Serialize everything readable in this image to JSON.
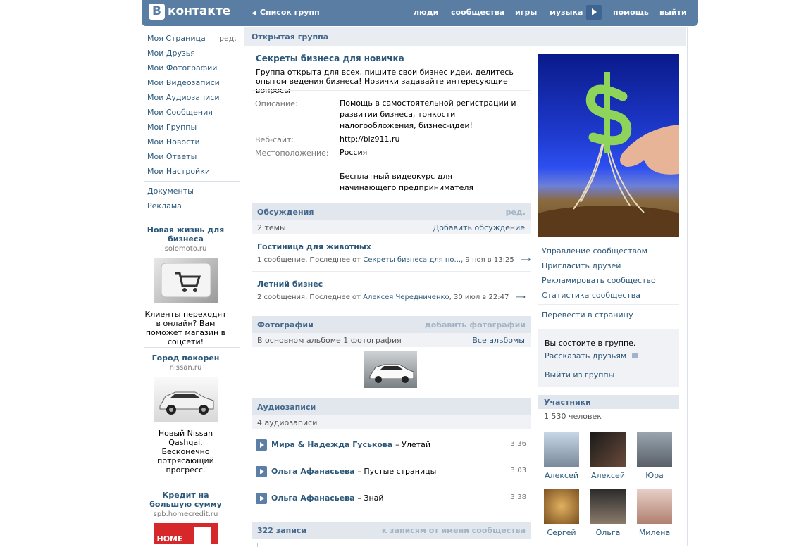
{
  "header": {
    "logo_letter": "В",
    "logo_text": "контакте",
    "back_label": "Список групп",
    "nav": [
      "люди",
      "сообщества",
      "игры",
      "музыка",
      "помощь",
      "выйти"
    ]
  },
  "sidebar": {
    "items": [
      "Моя Страница",
      "Мои Друзья",
      "Мои Фотографии",
      "Мои Видеозаписи",
      "Мои Аудиозаписи",
      "Мои Сообщения",
      "Мои Группы",
      "Мои Новости",
      "Мои Ответы",
      "Мои Настройки"
    ],
    "edit_label": "ред.",
    "extra": [
      "Документы",
      "Реклама"
    ],
    "ads": [
      {
        "title": "Новая жизнь для бизнеса",
        "domain": "solomoto.ru",
        "text": "Клиенты переходят в онлайн? Вам поможет магазин в соцсети!"
      },
      {
        "title": "Город покорен",
        "domain": "nissan.ru",
        "text": "Новый Nissan Qashqai. Бесконечно потрясающий прогресс."
      },
      {
        "title": "Кредит на большую сумму",
        "domain": "spb.homecredit.ru",
        "image_text": "HOME"
      }
    ]
  },
  "group": {
    "type_label": "Открытая группа",
    "name": "Секреты бизнеса для новичка",
    "status": "Группа открыта для всех, пишите свои бизнес идеи, делитесь опытом ведения бизнеса! Новички задавайте интересующие вопросы",
    "info": [
      {
        "label": "Описание:",
        "value": "Помощь в самостоятельной регистрации и развитии бизнеса, тонкости налогообложения, бизнес-идеи!"
      },
      {
        "label": "Веб-сайт:",
        "value": "http://biz911.ru"
      },
      {
        "label": "Местоположение:",
        "value": "Россия"
      }
    ],
    "promo": "Бесплатный видеокурс для начинающего предпринимателя"
  },
  "discussions": {
    "title": "Обсуждения",
    "edit": "ред.",
    "count": "2 темы",
    "add": "Добавить обсуждение",
    "topics": [
      {
        "title": "Гостиница для животных",
        "meta_prefix": "1 сообщение. Последнее от",
        "author": "Секреты бизнеса для но...",
        "date": ", 9 ноя в 13:25"
      },
      {
        "title": "Летний бизнес",
        "meta_prefix": "2 сообщения. Последнее от",
        "author": "Алексея Чередниченко",
        "date": ", 30 июл в 22:47"
      }
    ],
    "arrow": "⟶"
  },
  "photos": {
    "title": "Фотографии",
    "add": "добавить фотографии",
    "count": "В основном альбоме 1 фотография",
    "all": "Все альбомы"
  },
  "audio": {
    "title": "Аудиозаписи",
    "count": "4 аудиозаписи",
    "tracks": [
      {
        "artist": "Мира & Надежда Гуськова",
        "title": "– Улетай",
        "duration": "3:36"
      },
      {
        "artist": "Ольга Афанасьева",
        "title": "– Пустые страницы",
        "duration": "3:03"
      },
      {
        "artist": "Ольга Афанасьева",
        "title": "– Знай",
        "duration": "3:38"
      }
    ]
  },
  "wall": {
    "count": "322 записи",
    "link": "к записям от имени сообщества"
  },
  "actions": {
    "links": [
      "Управление сообществом",
      "Пригласить друзей",
      "Рекламировать сообщество",
      "Статистика сообщества"
    ],
    "convert": "Перевести в страницу",
    "member_status": "Вы состоите в группе.",
    "tell": "Рассказать друзьям",
    "leave": "Выйти из группы"
  },
  "members": {
    "title": "Участники",
    "count": "1 530 человек",
    "list": [
      "Алексей",
      "Алексей",
      "Юра",
      "Сергей",
      "Ольга",
      "Милена"
    ]
  },
  "colors": {
    "header_bg": "#597da3",
    "link": "#2b587a",
    "section_head": "#e1e7ed"
  }
}
